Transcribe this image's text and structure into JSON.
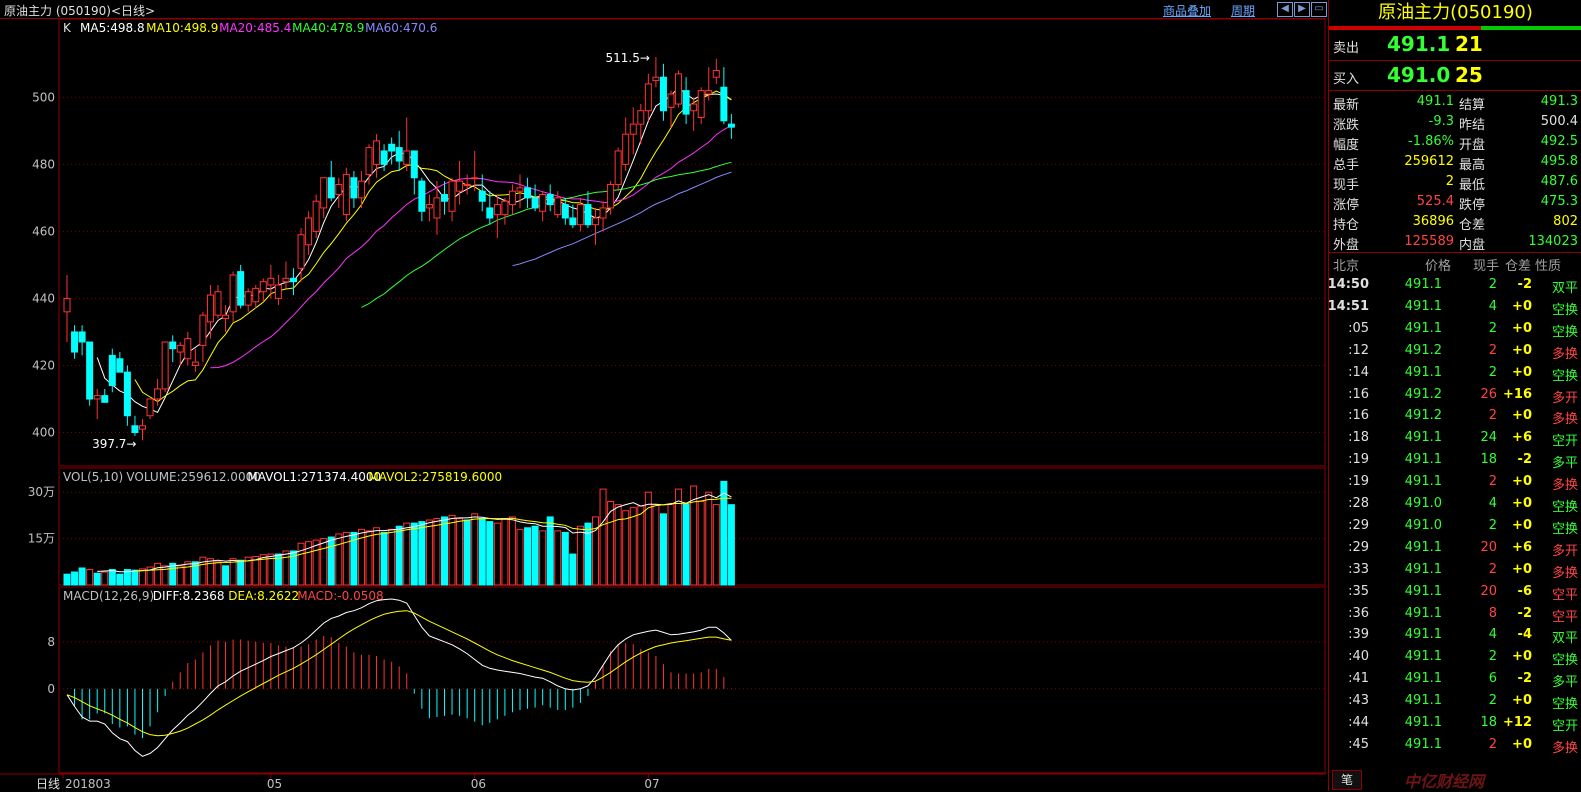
{
  "header": {
    "title": "原油主力 (050190)<日线>",
    "link_overlay": "商品叠加",
    "link_period": "周期",
    "nav_prev": "◀",
    "nav_next": "▶",
    "nav_full": "▭"
  },
  "chart_data": [
    {
      "type": "candlestick",
      "title": "K",
      "ylim": [
        390,
        518
      ],
      "yticks": [
        400,
        420,
        440,
        460,
        480,
        500
      ],
      "xlabels": [
        "日线",
        "201803",
        "05",
        "06",
        "07"
      ],
      "indicators": [
        {
          "label": "MA5:498.8",
          "color": "#ffffff"
        },
        {
          "label": "MA10:498.9",
          "color": "#ffff00"
        },
        {
          "label": "MA20:485.4",
          "color": "#ff33ff"
        },
        {
          "label": "MA40:478.9",
          "color": "#33ff33"
        },
        {
          "label": "MA60:470.6",
          "color": "#8888ff"
        }
      ],
      "annotations": [
        {
          "text": "511.5",
          "value": 511.5
        },
        {
          "text": "397.7",
          "value": 397.7
        }
      ],
      "ohlc": [
        [
          436,
          447,
          427,
          440
        ],
        [
          430,
          432,
          422,
          424
        ],
        [
          430,
          432,
          423,
          427
        ],
        [
          427,
          427,
          408,
          410
        ],
        [
          410,
          413,
          404,
          411
        ],
        [
          411,
          413,
          409,
          409
        ],
        [
          423,
          425,
          412,
          414
        ],
        [
          422,
          424,
          418,
          418
        ],
        [
          418,
          420,
          402,
          405
        ],
        [
          402,
          405,
          399,
          400
        ],
        [
          401,
          404,
          397.7,
          402
        ],
        [
          405,
          410,
          404,
          410
        ],
        [
          410,
          416,
          408,
          413
        ],
        [
          413,
          427,
          412,
          427
        ],
        [
          427,
          429,
          421,
          425
        ],
        [
          424,
          427,
          420,
          426
        ],
        [
          422,
          430,
          420,
          428
        ],
        [
          420,
          425,
          418,
          421
        ],
        [
          426,
          436,
          421,
          435
        ],
        [
          433,
          444,
          428,
          441
        ],
        [
          435,
          444,
          434,
          442
        ],
        [
          434,
          438,
          430,
          435
        ],
        [
          436,
          448,
          433,
          447
        ],
        [
          448,
          450,
          437,
          438
        ],
        [
          438,
          443,
          436,
          442
        ],
        [
          439,
          444,
          437,
          443
        ],
        [
          442,
          446,
          439,
          445
        ],
        [
          444,
          450,
          440,
          446
        ],
        [
          440,
          447,
          438,
          444
        ],
        [
          445,
          451,
          443,
          446
        ],
        [
          446,
          449,
          441,
          445
        ],
        [
          449,
          461,
          445,
          459
        ],
        [
          456,
          466,
          453,
          464
        ],
        [
          460,
          471,
          458,
          469
        ],
        [
          467,
          476,
          464,
          476
        ],
        [
          476,
          481,
          469,
          470
        ],
        [
          471,
          476,
          467,
          474
        ],
        [
          465,
          479,
          463,
          477
        ],
        [
          476,
          478,
          467,
          470
        ],
        [
          470,
          478,
          467,
          475
        ],
        [
          477,
          486,
          474,
          485
        ],
        [
          480,
          489,
          476,
          487
        ],
        [
          484,
          486,
          478,
          480
        ],
        [
          486,
          488,
          480,
          484
        ],
        [
          485,
          490,
          478,
          481
        ],
        [
          480,
          494,
          478,
          484
        ],
        [
          484,
          484,
          471,
          476
        ],
        [
          475,
          476,
          463,
          466
        ],
        [
          467,
          471,
          463,
          468
        ],
        [
          464,
          475,
          459,
          470
        ],
        [
          471,
          475,
          465,
          469
        ],
        [
          466,
          476,
          463,
          475
        ],
        [
          472,
          481,
          468,
          475
        ],
        [
          474,
          477,
          471,
          474
        ],
        [
          476,
          484,
          472,
          476
        ],
        [
          472,
          477,
          466,
          469
        ],
        [
          467,
          472,
          462,
          464
        ],
        [
          465,
          471,
          458,
          468
        ],
        [
          465,
          470,
          462,
          469
        ],
        [
          468,
          474,
          465,
          472
        ],
        [
          472,
          477,
          467,
          473
        ],
        [
          473,
          476,
          467,
          470
        ],
        [
          470,
          474,
          466,
          467
        ],
        [
          466,
          472,
          463,
          471
        ],
        [
          471,
          474,
          466,
          468
        ],
        [
          465,
          472,
          464,
          470
        ],
        [
          468,
          470,
          462,
          464
        ],
        [
          464,
          468,
          461,
          462
        ],
        [
          462,
          470,
          460,
          468
        ],
        [
          468,
          472,
          461,
          462
        ],
        [
          462,
          467,
          456,
          464
        ],
        [
          464,
          469,
          460,
          467
        ],
        [
          467,
          475,
          465,
          474
        ],
        [
          474,
          485,
          472,
          484
        ],
        [
          480,
          494,
          478,
          489
        ],
        [
          489,
          497,
          483,
          492
        ],
        [
          492,
          498,
          486,
          496
        ],
        [
          496,
          507,
          493,
          504
        ],
        [
          505,
          512,
          503,
          506
        ],
        [
          506,
          510,
          493,
          496
        ],
        [
          497,
          502,
          491,
          501
        ],
        [
          498,
          508,
          497,
          507
        ],
        [
          502,
          506,
          492,
          495
        ],
        [
          496,
          500,
          490,
          498
        ],
        [
          494,
          503,
          492,
          502
        ],
        [
          501,
          509,
          499,
          502
        ],
        [
          506,
          511.5,
          504,
          508
        ],
        [
          503,
          509,
          492,
          493
        ],
        [
          492,
          495,
          487.6,
          491.1
        ]
      ]
    },
    {
      "type": "bar",
      "title": "VOL(5,10)",
      "indicators": [
        {
          "label": "VOLUME:259612.0000",
          "color": "#c0c0c0"
        },
        {
          "label": "MAVOL1:271374.4000",
          "color": "#ffffff"
        },
        {
          "label": "MAVOL2:275819.6000",
          "color": "#ffff00"
        }
      ],
      "yticks": [
        {
          "value": 150000,
          "label": "15万"
        },
        {
          "value": 300000,
          "label": "30万"
        }
      ],
      "ylim": [
        0,
        320000
      ],
      "values": [
        35000,
        42000,
        55000,
        50000,
        38000,
        42000,
        50000,
        35000,
        50000,
        48000,
        52000,
        58000,
        70000,
        62000,
        70000,
        62000,
        75000,
        75000,
        90000,
        85000,
        75000,
        62000,
        85000,
        80000,
        90000,
        92000,
        98000,
        100000,
        100000,
        110000,
        110000,
        135000,
        140000,
        145000,
        150000,
        155000,
        165000,
        170000,
        170000,
        180000,
        175000,
        185000,
        170000,
        180000,
        190000,
        200000,
        200000,
        205000,
        210000,
        215000,
        220000,
        225000,
        215000,
        210000,
        230000,
        215000,
        205000,
        200000,
        215000,
        220000,
        180000,
        185000,
        190000,
        175000,
        220000,
        175000,
        170000,
        100000,
        190000,
        200000,
        220000,
        310000,
        270000,
        260000,
        240000,
        250000,
        255000,
        300000,
        260000,
        230000,
        260000,
        310000,
        260000,
        320000,
        270000,
        300000,
        260000,
        335000,
        259612
      ],
      "down": [
        1,
        1,
        1,
        0,
        1,
        0,
        1,
        1,
        1,
        1,
        0,
        0,
        0,
        0,
        1,
        0,
        0,
        1,
        0,
        0,
        0,
        1,
        0,
        1,
        0,
        0,
        0,
        0,
        1,
        0,
        1,
        0,
        0,
        0,
        0,
        1,
        0,
        0,
        1,
        0,
        0,
        0,
        1,
        0,
        1,
        0,
        1,
        1,
        0,
        0,
        1,
        0,
        0,
        1,
        0,
        1,
        1,
        0,
        0,
        0,
        0,
        1,
        1,
        0,
        1,
        0,
        1,
        1,
        0,
        1,
        0,
        0,
        0,
        0,
        0,
        0,
        0,
        0,
        0,
        1,
        0,
        0,
        1,
        0,
        0,
        0,
        0,
        1,
        1
      ]
    },
    {
      "type": "line",
      "title": "MACD(12,26,9)",
      "indicators": [
        {
          "label": "DIFF:8.2368",
          "color": "#ffffff"
        },
        {
          "label": "DEA:8.2622",
          "color": "#ffff00"
        },
        {
          "label": "MACD:-0.0508",
          "color": "#ff4444"
        }
      ],
      "ylim": [
        -14,
        17
      ],
      "yticks": [
        0,
        8
      ],
      "diff": [
        -1.0,
        -3.0,
        -4.8,
        -5.5,
        -5.5,
        -6.0,
        -7.5,
        -8.5,
        -9.0,
        -10.5,
        -11.5,
        -11.0,
        -10.0,
        -8.5,
        -7.0,
        -5.8,
        -4.5,
        -3.5,
        -2.2,
        -0.8,
        0.5,
        1.2,
        2.2,
        3.0,
        3.6,
        4.2,
        4.8,
        5.5,
        6.0,
        6.5,
        7.0,
        7.8,
        8.8,
        10.0,
        11.2,
        12.0,
        12.4,
        13.0,
        13.3,
        13.8,
        14.5,
        15.0,
        15.2,
        15.3,
        15.1,
        14.6,
        12.5,
        10.5,
        9.0,
        8.5,
        8.0,
        7.5,
        6.8,
        6.0,
        5.0,
        4.0,
        3.5,
        3.2,
        3.0,
        2.8,
        2.6,
        2.3,
        2.0,
        1.8,
        1.2,
        0.5,
        0.0,
        -0.2,
        0.0,
        0.5,
        2.0,
        4.0,
        6.0,
        7.5,
        8.5,
        9.2,
        9.5,
        9.8,
        10.0,
        9.6,
        9.2,
        9.3,
        9.5,
        9.7,
        10.0,
        10.5,
        10.5,
        9.5,
        8.24
      ],
      "dea": [
        -1.0,
        -1.5,
        -2.2,
        -2.9,
        -3.4,
        -3.9,
        -4.5,
        -5.2,
        -5.8,
        -6.6,
        -7.3,
        -7.8,
        -8.0,
        -7.9,
        -7.6,
        -7.2,
        -6.7,
        -6.0,
        -5.3,
        -4.5,
        -3.6,
        -2.8,
        -2.0,
        -1.2,
        -0.5,
        0.2,
        0.9,
        1.6,
        2.3,
        2.9,
        3.5,
        4.2,
        5.0,
        5.8,
        6.7,
        7.6,
        8.5,
        9.4,
        10.2,
        10.9,
        11.6,
        12.2,
        12.7,
        13.0,
        13.2,
        13.3,
        12.9,
        12.2,
        11.5,
        10.9,
        10.3,
        9.7,
        9.1,
        8.5,
        7.8,
        7.1,
        6.4,
        5.8,
        5.3,
        4.8,
        4.4,
        4.0,
        3.6,
        3.2,
        2.8,
        2.3,
        1.8,
        1.4,
        1.2,
        1.1,
        1.3,
        2.0,
        2.8,
        3.7,
        4.6,
        5.4,
        6.1,
        6.7,
        7.2,
        7.5,
        7.8,
        8.0,
        8.2,
        8.4,
        8.6,
        8.8,
        8.8,
        8.5,
        8.26
      ]
    }
  ],
  "quote": {
    "title": "原油主力(050190)",
    "sell_label": "卖出",
    "sell_price": "491.1",
    "sell_vol": "21",
    "buy_label": "买入",
    "buy_price": "491.0",
    "buy_vol": "25",
    "rows": [
      {
        "l1": "最新",
        "v1": "491.1",
        "c1": "#33ff33",
        "l2": "结算",
        "v2": "491.3",
        "c2": "#33ff33"
      },
      {
        "l1": "涨跌",
        "v1": "-9.3",
        "c1": "#33ff33",
        "l2": "昨结",
        "v2": "500.4",
        "c2": "#e0e0e0"
      },
      {
        "l1": "幅度",
        "v1": "-1.86%",
        "c1": "#33ff33",
        "l2": "开盘",
        "v2": "492.5",
        "c2": "#33ff33"
      },
      {
        "l1": "总手",
        "v1": "259612",
        "c1": "#ffff00",
        "l2": "最高",
        "v2": "495.8",
        "c2": "#33ff33"
      },
      {
        "l1": "现手",
        "v1": "2",
        "c1": "#ffff00",
        "l2": "最低",
        "v2": "487.6",
        "c2": "#33ff33"
      },
      {
        "l1": "涨停",
        "v1": "525.4",
        "c1": "#ff4444",
        "l2": "跌停",
        "v2": "475.3",
        "c2": "#33ff33"
      },
      {
        "l1": "持仓",
        "v1": "36896",
        "c1": "#ffff00",
        "l2": "仓差",
        "v2": "802",
        "c2": "#ffff00"
      },
      {
        "l1": "外盘",
        "v1": "125589",
        "c1": "#ff4444",
        "l2": "内盘",
        "v2": "134023",
        "c2": "#33ff33"
      }
    ]
  },
  "ticks": {
    "headers": [
      "北京",
      "价格",
      "现手",
      "仓差",
      "性质"
    ],
    "rows": [
      {
        "t": "14:50",
        "p": "491.1",
        "v": "2",
        "vc": "#33ff33",
        "d": "-2",
        "n": "双平",
        "nc": "#33ff33"
      },
      {
        "t": "14:51",
        "p": "491.1",
        "v": "4",
        "vc": "#33ff33",
        "d": "+0",
        "n": "空换",
        "nc": "#33ff33"
      },
      {
        "t": ":05",
        "p": "491.1",
        "v": "2",
        "vc": "#33ff33",
        "d": "+0",
        "n": "空换",
        "nc": "#33ff33"
      },
      {
        "t": ":12",
        "p": "491.2",
        "v": "2",
        "vc": "#ff4444",
        "d": "+0",
        "n": "多换",
        "nc": "#ff4444"
      },
      {
        "t": ":14",
        "p": "491.1",
        "v": "2",
        "vc": "#33ff33",
        "d": "+0",
        "n": "空换",
        "nc": "#33ff33"
      },
      {
        "t": ":16",
        "p": "491.2",
        "v": "26",
        "vc": "#ff4444",
        "d": "+16",
        "n": "多开",
        "nc": "#ff4444"
      },
      {
        "t": ":16",
        "p": "491.2",
        "v": "2",
        "vc": "#ff4444",
        "d": "+0",
        "n": "多换",
        "nc": "#ff4444"
      },
      {
        "t": ":18",
        "p": "491.1",
        "v": "24",
        "vc": "#33ff33",
        "d": "+6",
        "n": "空开",
        "nc": "#33ff33"
      },
      {
        "t": ":19",
        "p": "491.1",
        "v": "18",
        "vc": "#33ff33",
        "d": "-2",
        "n": "多平",
        "nc": "#33ff33"
      },
      {
        "t": ":19",
        "p": "491.1",
        "v": "2",
        "vc": "#ff4444",
        "d": "+0",
        "n": "多换",
        "nc": "#ff4444"
      },
      {
        "t": ":28",
        "p": "491.0",
        "v": "4",
        "vc": "#33ff33",
        "d": "+0",
        "n": "空换",
        "nc": "#33ff33"
      },
      {
        "t": ":29",
        "p": "491.0",
        "v": "2",
        "vc": "#33ff33",
        "d": "+0",
        "n": "空换",
        "nc": "#33ff33"
      },
      {
        "t": ":29",
        "p": "491.1",
        "v": "20",
        "vc": "#ff4444",
        "d": "+6",
        "n": "多开",
        "nc": "#ff4444"
      },
      {
        "t": ":33",
        "p": "491.1",
        "v": "2",
        "vc": "#ff4444",
        "d": "+0",
        "n": "多换",
        "nc": "#ff4444"
      },
      {
        "t": ":35",
        "p": "491.1",
        "v": "20",
        "vc": "#ff4444",
        "d": "-6",
        "n": "空平",
        "nc": "#ff4444"
      },
      {
        "t": ":36",
        "p": "491.1",
        "v": "8",
        "vc": "#ff4444",
        "d": "-2",
        "n": "空平",
        "nc": "#ff4444"
      },
      {
        "t": ":39",
        "p": "491.1",
        "v": "4",
        "vc": "#33ff33",
        "d": "-4",
        "n": "双平",
        "nc": "#33ff33"
      },
      {
        "t": ":40",
        "p": "491.1",
        "v": "2",
        "vc": "#33ff33",
        "d": "+0",
        "n": "空换",
        "nc": "#33ff33"
      },
      {
        "t": ":41",
        "p": "491.1",
        "v": "6",
        "vc": "#33ff33",
        "d": "-2",
        "n": "多平",
        "nc": "#33ff33"
      },
      {
        "t": ":43",
        "p": "491.1",
        "v": "2",
        "vc": "#33ff33",
        "d": "+0",
        "n": "空换",
        "nc": "#33ff33"
      },
      {
        "t": ":44",
        "p": "491.1",
        "v": "18",
        "vc": "#33ff33",
        "d": "+12",
        "n": "空开",
        "nc": "#33ff33"
      },
      {
        "t": ":45",
        "p": "491.1",
        "v": "2",
        "vc": "#ff4444",
        "d": "+0",
        "n": "多换",
        "nc": "#ff4444"
      }
    ]
  },
  "bottom_tab": "笔",
  "watermark": "中亿财经网"
}
